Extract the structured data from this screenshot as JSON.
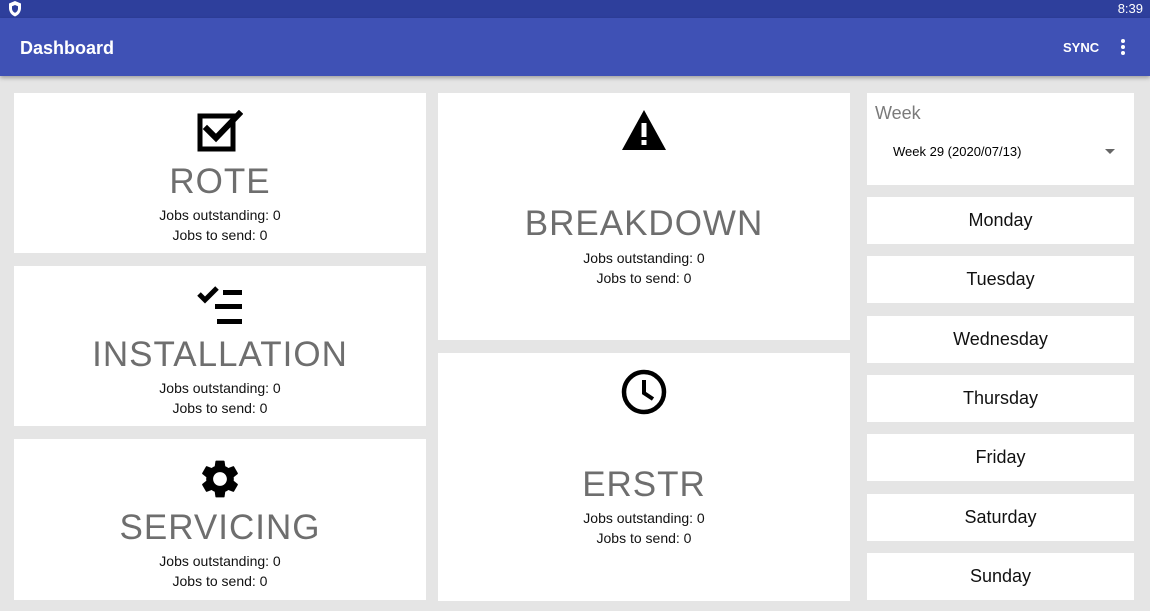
{
  "status": {
    "time": "8:39",
    "shield_icon": "shield-icon"
  },
  "appbar": {
    "title": "Dashboard",
    "sync_label": "SYNC",
    "menu_icon": "more-vert-icon"
  },
  "cards": {
    "rote": {
      "title": "ROTE",
      "outstanding": "Jobs outstanding: 0",
      "to_send": "Jobs to send: 0",
      "icon": "checkbox-icon"
    },
    "installation": {
      "title": "INSTALLATION",
      "outstanding": "Jobs outstanding: 0",
      "to_send": "Jobs to send: 0",
      "icon": "checklist-icon"
    },
    "servicing": {
      "title": "SERVICING",
      "outstanding": "Jobs outstanding: 0",
      "to_send": "Jobs to send: 0",
      "icon": "gear-icon"
    },
    "breakdown": {
      "title": "BREAKDOWN",
      "outstanding": "Jobs outstanding: 0",
      "to_send": "Jobs to send: 0",
      "icon": "warning-icon"
    },
    "erstr": {
      "title": "ERSTR",
      "outstanding": "Jobs outstanding: 0",
      "to_send": "Jobs to send: 0",
      "icon": "clock-icon"
    }
  },
  "week": {
    "label": "Week",
    "selected": "Week 29 (2020/07/13)"
  },
  "days": [
    "Monday",
    "Tuesday",
    "Wednesday",
    "Thursday",
    "Friday",
    "Saturday",
    "Sunday"
  ],
  "colors": {
    "statusbar": "#2e3f9c",
    "appbar": "#3f51b5",
    "background": "#e5e5e5",
    "card_title": "#6e6e6e"
  }
}
